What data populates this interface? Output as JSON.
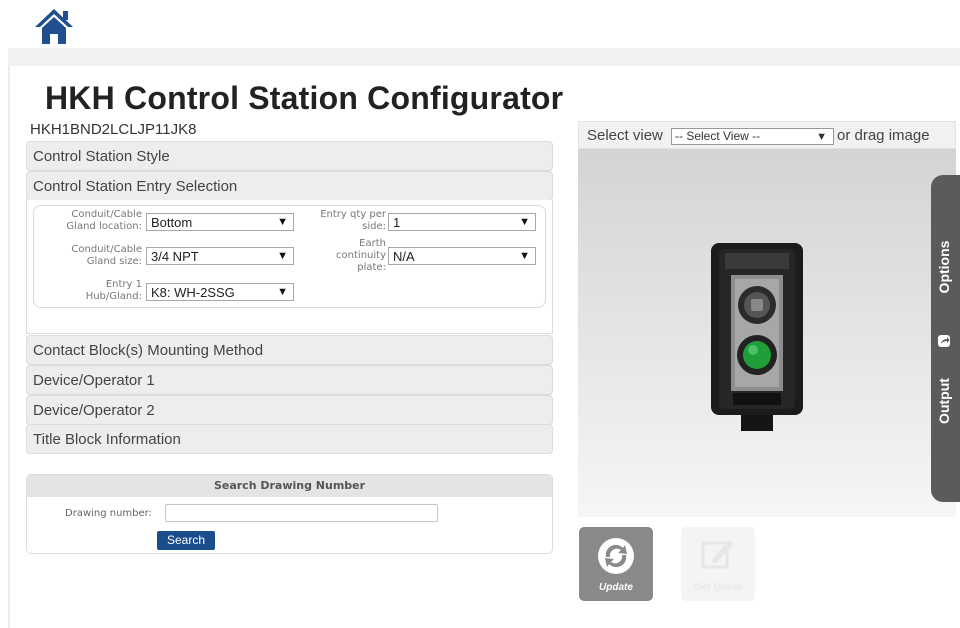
{
  "title": "HKH Control Station Configurator",
  "part_number": "HKH1BND2LCLJP11JK8",
  "accordion": {
    "style": "Control Station Style",
    "entry": "Control Station Entry Selection",
    "contact": "Contact Block(s) Mounting Method",
    "device1": "Device/Operator 1",
    "device2": "Device/Operator 2",
    "title_block": "Title Block Information"
  },
  "entry_form": {
    "location_label_1": "Conduit/Cable",
    "location_label_2": "Gland location:",
    "location_value": "Bottom",
    "size_label_1": "Conduit/Cable",
    "size_label_2": "Gland size:",
    "size_value": "3/4 NPT",
    "hub_label_1": "Entry 1",
    "hub_label_2": "Hub/Gland:",
    "hub_value": "K8: WH-2SSG",
    "qty_label_1": "Entry qty per",
    "qty_label_2": "side:",
    "qty_value": "1",
    "earth_label_1": "Earth",
    "earth_label_2": "continuity",
    "earth_label_3": "plate:",
    "earth_value": "N/A"
  },
  "search": {
    "header": "Search Drawing Number",
    "label": "Drawing number:",
    "value": "",
    "button": "Search"
  },
  "viewer": {
    "select_label": "Select view",
    "select_value": "-- Select View --",
    "drag_text": "or drag image",
    "tab_options": "Options",
    "tab_output": "Output"
  },
  "actions": {
    "update": "Update",
    "quote": "Get Quote"
  },
  "colors": {
    "home_icon": "#1f4f8f",
    "search_button": "#1b4d8c",
    "side_tab": "#5b5b5b",
    "update_tile": "#8a8a8a",
    "green_button": "#1f9e3a"
  }
}
